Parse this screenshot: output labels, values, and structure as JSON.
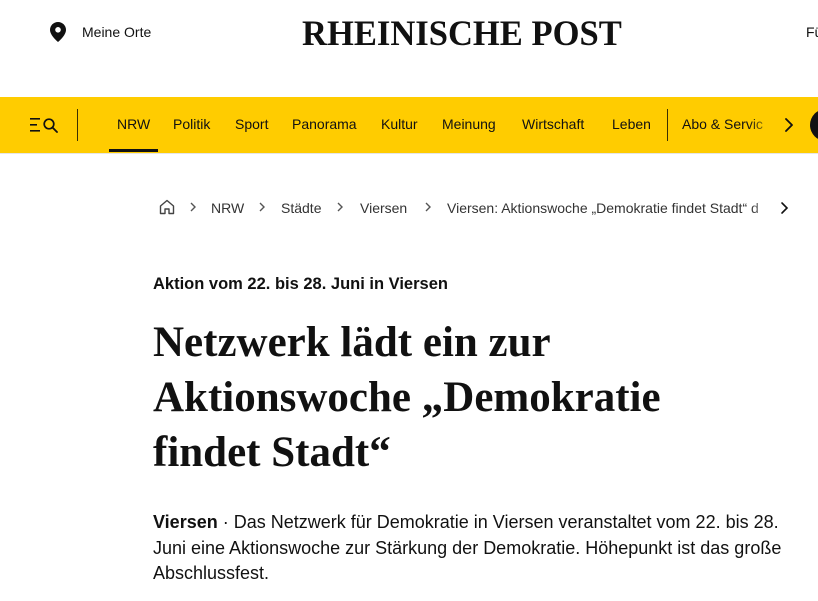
{
  "header": {
    "locations_label": "Meine Orte",
    "brand": "RHEINISCHE POST",
    "right_cutoff": "Fü"
  },
  "nav": {
    "menu_icon": "menu-search-icon",
    "items": [
      {
        "label": "NRW",
        "active": true
      },
      {
        "label": "Politik"
      },
      {
        "label": "Sport"
      },
      {
        "label": "Panorama"
      },
      {
        "label": "Kultur"
      },
      {
        "label": "Meinung"
      },
      {
        "label": "Wirtschaft"
      },
      {
        "label": "Leben"
      },
      {
        "label": "Abo & Servic"
      }
    ],
    "accent_color": "#ffcc00"
  },
  "breadcrumb": {
    "items": [
      "NRW",
      "Städte",
      "Viersen"
    ],
    "current": "Viersen: Aktionswoche „Demokratie findet Stadt“ d"
  },
  "article": {
    "kicker": "Aktion vom 22. bis 28. Juni in Viersen",
    "headline": "Netzwerk lädt ein zur Aktionswoche „Demokratie findet Stadt“",
    "dateline": "Viersen",
    "lead": " · Das Netzwerk für Demokratie in Viersen veranstaltet vom 22. bis 28. Juni eine Aktionswoche zur Stärkung der Demokratie. Höhepunkt ist das große Abschlussfest."
  }
}
